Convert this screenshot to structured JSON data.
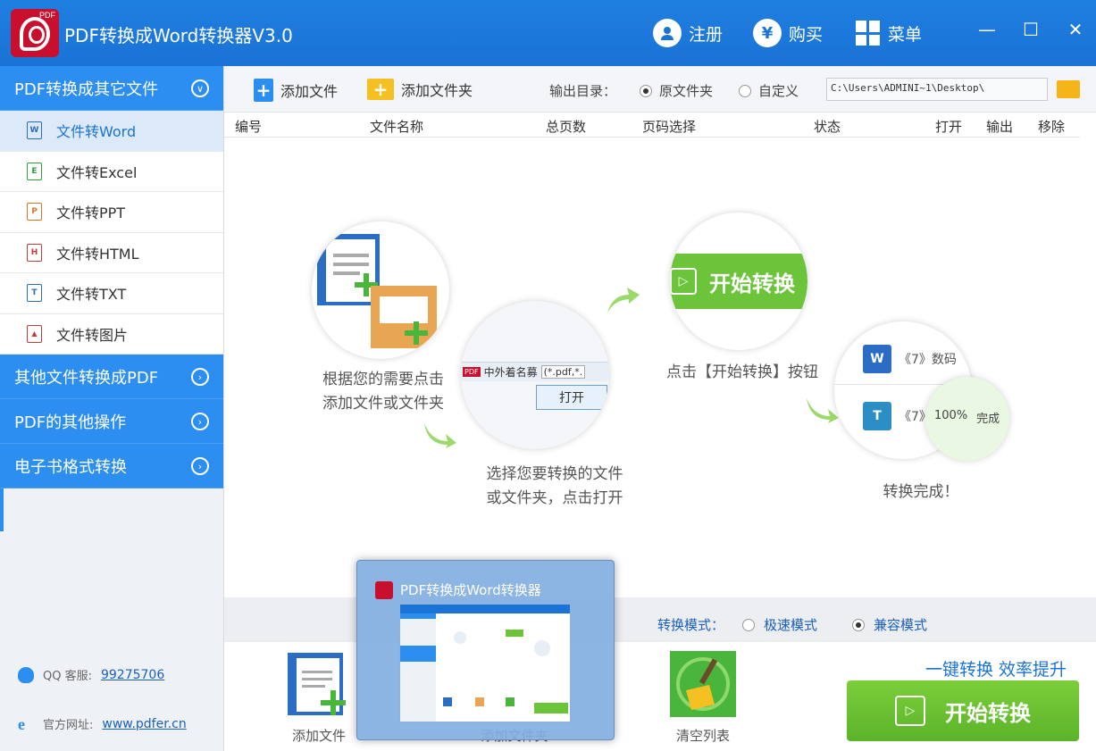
{
  "app": {
    "title": "PDF转换成Word转换器V3.0",
    "logo_tag": "PDF",
    "register_label": "注册",
    "buy_label": "购买",
    "menu_label": "菜单",
    "buy_glyph": "¥",
    "minimize_glyph": "—",
    "maximize_glyph": "☐",
    "close_glyph": "✕"
  },
  "sidebar": {
    "groups": [
      {
        "label": "PDF转换成其它文件",
        "expanded": true
      },
      {
        "label": "其他文件转换成PDF"
      },
      {
        "label": "PDF的其他操作"
      },
      {
        "label": "电子书格式转换"
      }
    ],
    "items": [
      {
        "label": "文件转Word",
        "icon": "W",
        "color": "#2b6cc4",
        "active": true
      },
      {
        "label": "文件转Excel",
        "icon": "E",
        "color": "#2e9b3e"
      },
      {
        "label": "文件转PPT",
        "icon": "P",
        "color": "#d8732a"
      },
      {
        "label": "文件转HTML",
        "icon": "H",
        "color": "#c23a3a"
      },
      {
        "label": "文件转TXT",
        "icon": "T",
        "color": "#2b6cc4"
      },
      {
        "label": "文件转图片",
        "icon": "▲",
        "color": "#c23a3a"
      }
    ],
    "qq_label": "QQ 客服:",
    "qq_number": "99275706",
    "site_label": "官方网址:",
    "site_url": "www.pdfer.cn"
  },
  "toolbar": {
    "add_file": "添加文件",
    "add_folder": "添加文件夹",
    "output_label": "输出目录：",
    "option_original": "原文件夹",
    "option_custom": "自定义",
    "output_path": "C:\\Users\\ADMINI~1\\Desktop\\"
  },
  "table": {
    "columns": [
      "编号",
      "文件名称",
      "总页数",
      "页码选择",
      "状态",
      "打开",
      "输出",
      "移除"
    ]
  },
  "steps": {
    "step1_line1": "根据您的需要点击",
    "step1_line2": "添加文件或文件夹",
    "step2_line1": "选择您要转换的文件",
    "step2_line2": "或文件夹，点击打开",
    "step2_dialog_file": "中外着名募",
    "step2_dialog_filter": "(*.pdf,*.",
    "step2_dialog_open": "打开",
    "step2_pdf_tag": "PDF",
    "step3_text": "点击【开始转换】按钮",
    "step3_button": "开始转换",
    "step4_text": "转换完成！",
    "step4_file1": "《7》数码",
    "step4_file2": "《7》",
    "step4_progress": "100%",
    "step4_done": "完成",
    "step4_w": "W",
    "step4_t": "T"
  },
  "mode": {
    "label": "转换模式：",
    "fast": "极速模式",
    "compat": "兼容模式",
    "selected": "compat"
  },
  "bottom": {
    "add_file": "添加文件",
    "add_folder": "添加文件夹",
    "clear_list": "清空列表",
    "slogan": "一键转换  效率提升",
    "start": "开始转换"
  },
  "preview": {
    "title": "PDF转换成Word转换器"
  },
  "colors": {
    "title_bar": "#1a73d6",
    "sidebar_group": "#2b8ef0",
    "start_green": "#5bb32a",
    "brand_red": "#c8102e"
  }
}
